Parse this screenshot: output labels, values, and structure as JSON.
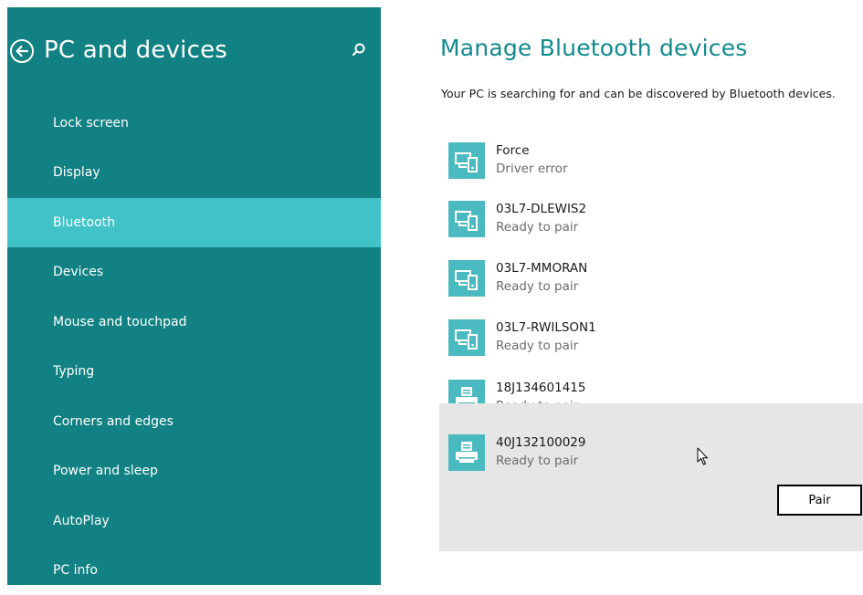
{
  "sidebar": {
    "title": "PC and devices",
    "nav_items": [
      {
        "label": "Lock screen"
      },
      {
        "label": "Display"
      },
      {
        "label": "Bluetooth",
        "selected": true
      },
      {
        "label": "Devices"
      },
      {
        "label": "Mouse and touchpad"
      },
      {
        "label": "Typing"
      },
      {
        "label": "Corners and edges"
      },
      {
        "label": "Power and sleep"
      },
      {
        "label": "AutoPlay"
      },
      {
        "label": "PC info"
      }
    ]
  },
  "main": {
    "title": "Manage Bluetooth devices",
    "status": "Your PC is searching for and can be discovered by Bluetooth devices.",
    "devices": [
      {
        "name": "Force",
        "status": "Driver error",
        "icon": "computer-phone-icon"
      },
      {
        "name": "03L7-DLEWIS2",
        "status": "Ready to pair",
        "icon": "computer-phone-icon"
      },
      {
        "name": "03L7-MMORAN",
        "status": "Ready to pair",
        "icon": "computer-phone-icon"
      },
      {
        "name": "03L7-RWILSON1",
        "status": "Ready to pair",
        "icon": "computer-phone-icon"
      },
      {
        "name": "18J134601415",
        "status": "Ready to pair",
        "icon": "printer-icon"
      },
      {
        "name": "40J132100029",
        "status": "Ready to pair",
        "icon": "printer-icon",
        "selected": true
      }
    ],
    "pair_label": "Pair"
  },
  "colors": {
    "sidebar_bg": "#128183",
    "sidebar_selected": "#41c2c7",
    "title_accent": "#138a8e",
    "icon_bg": "#4bbac0",
    "selected_row_bg": "#e6e6e6"
  }
}
